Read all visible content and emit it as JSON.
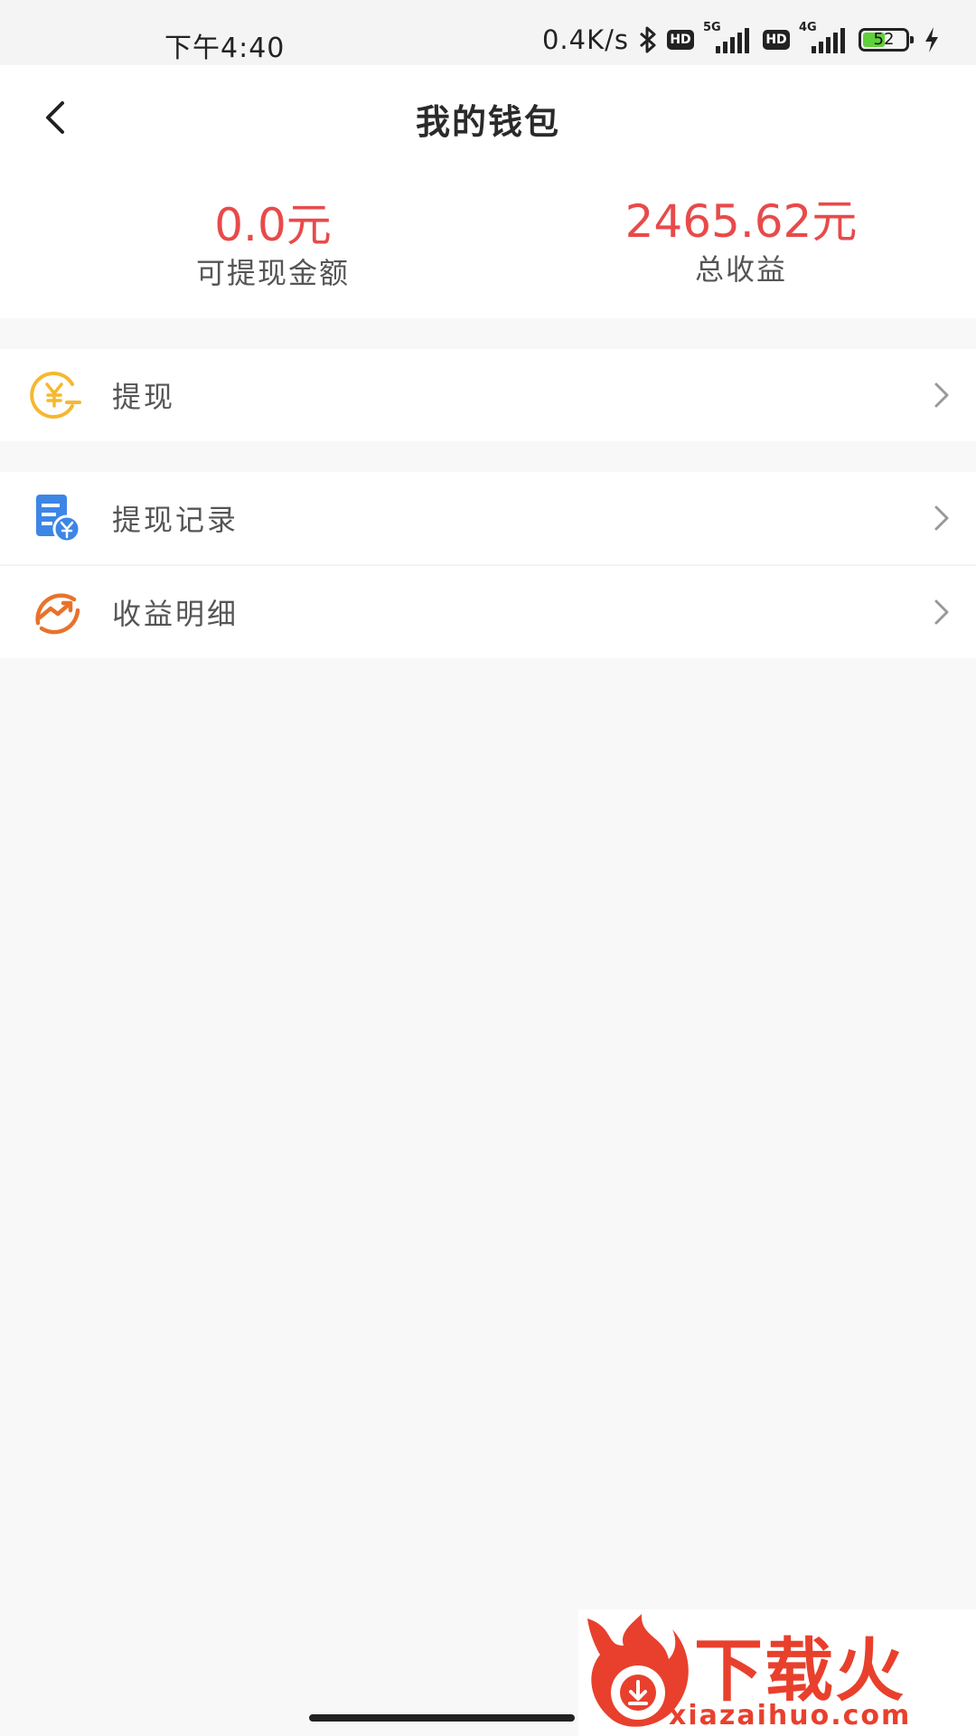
{
  "status_bar": {
    "time": "下午4:40",
    "net_speed": "0.4K/s",
    "hd_label": "HD",
    "sim1_label": "5G",
    "sim2_label": "4G",
    "battery": "52",
    "battery_level": 0.52
  },
  "header": {
    "title": "我的钱包"
  },
  "summary": {
    "withdrawable_amount": "0.0元",
    "withdrawable_label": "可提现金额",
    "total_amount": "2465.62元",
    "total_label": "总收益",
    "amount_color": "#e84a4a"
  },
  "menu": {
    "withdraw": {
      "label": "提现",
      "icon": "yuan-coin-icon"
    },
    "records": {
      "label": "提现记录",
      "icon": "document-yuan-icon"
    },
    "income": {
      "label": "收益明细",
      "icon": "trend-up-icon"
    }
  },
  "watermark": {
    "brand": "下载火",
    "url": "xiazaihuo.com",
    "color": "#e8402d"
  }
}
